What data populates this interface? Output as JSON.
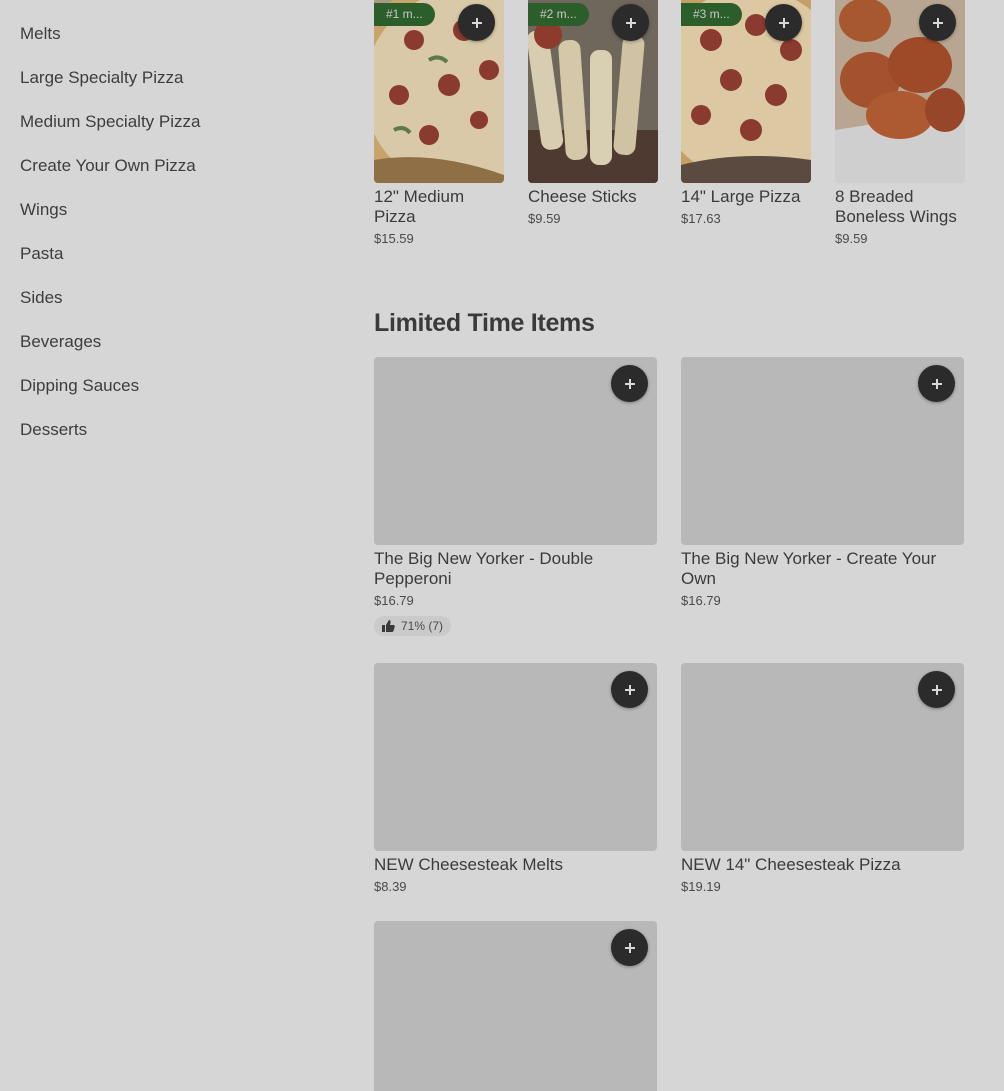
{
  "sidebar": {
    "items": [
      {
        "label": "Melts"
      },
      {
        "label": "Large Specialty Pizza"
      },
      {
        "label": "Medium Specialty Pizza"
      },
      {
        "label": "Create Your Own Pizza"
      },
      {
        "label": "Wings"
      },
      {
        "label": "Pasta"
      },
      {
        "label": "Sides"
      },
      {
        "label": "Beverages"
      },
      {
        "label": "Dipping Sauces"
      },
      {
        "label": "Desserts"
      }
    ]
  },
  "popular": {
    "items": [
      {
        "rank": "#1 m...",
        "name": "12\" Medium Pizza",
        "price": "$15.59"
      },
      {
        "rank": "#2 m...",
        "name": "Cheese Sticks",
        "price": "$9.59"
      },
      {
        "rank": "#3 m...",
        "name": "14\" Large Pizza",
        "price": "$17.63"
      },
      {
        "rank": "",
        "name": "8 Breaded Boneless Wings",
        "price": "$9.59"
      }
    ]
  },
  "limited": {
    "title": "Limited Time Items",
    "items": [
      {
        "name": "The Big New Yorker - Double Pepperoni",
        "price": "$16.79",
        "rating": "71% (7)"
      },
      {
        "name": "The Big New Yorker - Create Your Own",
        "price": "$16.79"
      },
      {
        "name": "NEW Cheesesteak Melts",
        "price": "$8.39"
      },
      {
        "name": "NEW 14\" Cheesesteak Pizza",
        "price": "$19.19"
      },
      {
        "name": "",
        "price": ""
      }
    ]
  },
  "icons": {
    "add": "plus-icon",
    "rating": "thumbs-up-icon"
  },
  "colors": {
    "background": "#d6d6d6",
    "badge": "#2b5e2b",
    "button": "#2b2b2b",
    "placeholder": "#b8b8b8"
  }
}
